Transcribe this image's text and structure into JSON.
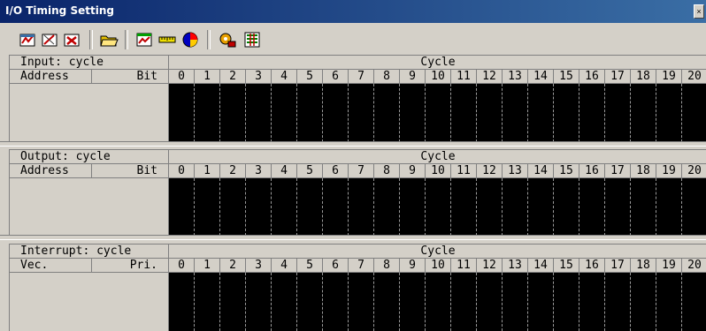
{
  "window": {
    "title": "I/O Timing Setting"
  },
  "toolbar": {
    "buttons": [
      {
        "icon": "new-input-icon",
        "color": "#c00000"
      },
      {
        "icon": "edit-input-icon",
        "color": "#c00000"
      },
      {
        "icon": "delete-input-icon",
        "color": "#c00000"
      },
      {
        "icon": "open-folder-icon",
        "color": "#e8b000"
      },
      {
        "icon": "chart-icon",
        "color": "#00a000"
      },
      {
        "icon": "ruler-icon",
        "color": "#e8d000"
      },
      {
        "icon": "pie-chart-icon",
        "color": "#0000c0"
      },
      {
        "icon": "settings-icon",
        "color": "#e8a000"
      },
      {
        "icon": "interrupt-icon",
        "color": "#008000"
      }
    ]
  },
  "cycle_numbers": [
    "0",
    "1",
    "2",
    "3",
    "4",
    "5",
    "6",
    "7",
    "8",
    "9",
    "10",
    "11",
    "12",
    "13",
    "14",
    "15",
    "16",
    "17",
    "18",
    "19",
    "20"
  ],
  "panels": {
    "input": {
      "title": "Input: cycle",
      "cycle_header": "Cycle",
      "col1": "Address",
      "col2": "Bit"
    },
    "output": {
      "title": "Output: cycle",
      "cycle_header": "Cycle",
      "col1": "Address",
      "col2": "Bit"
    },
    "interrupt": {
      "title": "Interrupt: cycle",
      "cycle_header": "Cycle",
      "col1": "Vec.",
      "col2": "Pri."
    }
  }
}
